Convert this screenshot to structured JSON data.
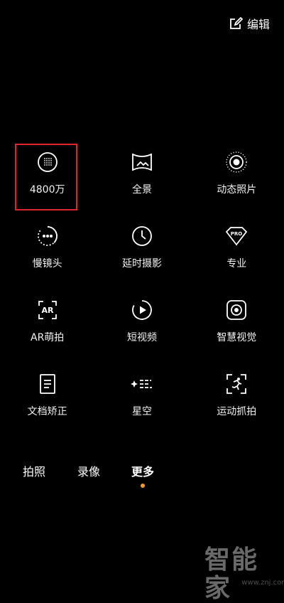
{
  "header": {
    "edit_label": "编辑",
    "edit_icon": "edit-square-icon"
  },
  "modes": [
    {
      "label": "4800万",
      "icon": "48mp-icon"
    },
    {
      "label": "全景",
      "icon": "panorama-icon"
    },
    {
      "label": "动态照片",
      "icon": "live-photo-icon"
    },
    {
      "label": "慢镜头",
      "icon": "slow-motion-icon"
    },
    {
      "label": "延时摄影",
      "icon": "timelapse-icon"
    },
    {
      "label": "专业",
      "icon": "pro-icon"
    },
    {
      "label": "AR萌拍",
      "icon": "ar-icon"
    },
    {
      "label": "短视频",
      "icon": "short-video-icon"
    },
    {
      "label": "智慧视觉",
      "icon": "smart-vision-icon"
    },
    {
      "label": "文档矫正",
      "icon": "document-icon"
    },
    {
      "label": "星空",
      "icon": "starry-sky-icon"
    },
    {
      "label": "运动抓拍",
      "icon": "sport-capture-icon"
    }
  ],
  "tabs": [
    {
      "label": "拍照",
      "active": false
    },
    {
      "label": "录像",
      "active": false
    },
    {
      "label": "更多",
      "active": true
    }
  ],
  "colors": {
    "highlight_box": "#e0252a",
    "active_dot": "#f29a2e"
  },
  "watermark": {
    "text": "智能家",
    "url": "www.znj.com"
  }
}
